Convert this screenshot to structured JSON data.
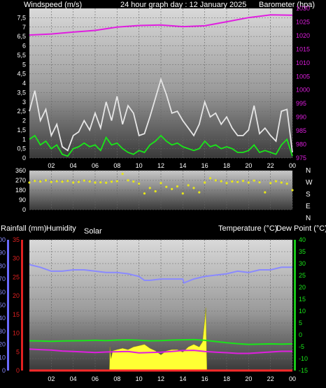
{
  "chart_data": [
    {
      "type": "line",
      "title": "24 hour graph day : 12 January 2025",
      "left_axis_label": "Windspeed (m/s)",
      "right_axis_label": "Barometer (hpa)",
      "x_tick_labels": [
        "02",
        "04",
        "06",
        "08",
        "10",
        "12",
        "14",
        "16",
        "18",
        "20",
        "22",
        "00"
      ],
      "left_ylim": [
        0,
        8
      ],
      "left_ticks": [
        "0",
        "0,5",
        "1",
        "1,5",
        "2",
        "2,5",
        "3",
        "3,5",
        "4",
        "4,5",
        "5",
        "5,5",
        "6",
        "6,5",
        "7",
        "7,5"
      ],
      "right_ylim": [
        975,
        1030
      ],
      "right_ticks": [
        "975",
        "980",
        "985",
        "990",
        "995",
        "1000",
        "1005",
        "1010",
        "1015",
        "1020",
        "1025",
        "1030"
      ],
      "grid": true,
      "series": [
        {
          "key": "barometer",
          "axis": "right",
          "color": "#e01ee0",
          "x": [
            0,
            2,
            4,
            6,
            8,
            10,
            12,
            14,
            16,
            18,
            20,
            22,
            24
          ],
          "values": [
            1020.2,
            1020.6,
            1021.3,
            1021.9,
            1023.1,
            1023.7,
            1023.9,
            1023.3,
            1023.6,
            1025.1,
            1026.6,
            1027.6,
            1027.5
          ]
        },
        {
          "key": "gust",
          "axis": "left",
          "color": "#e6e6e6",
          "x": [
            0,
            0.5,
            1,
            1.5,
            2,
            2.5,
            3,
            3.5,
            4,
            4.5,
            5,
            5.5,
            6,
            6.5,
            7,
            7.5,
            8,
            8.5,
            9,
            9.5,
            10,
            10.5,
            11,
            11.5,
            12,
            12.5,
            13,
            13.5,
            14,
            14.5,
            15,
            15.5,
            16,
            16.5,
            17,
            17.5,
            18,
            18.5,
            19,
            19.5,
            20,
            20.5,
            21,
            21.5,
            22,
            22.5,
            23,
            23.5,
            24
          ],
          "values": [
            2.5,
            3.6,
            2.0,
            2.6,
            1.2,
            1.8,
            0.6,
            0.4,
            1.2,
            1.4,
            2.0,
            1.5,
            2.4,
            1.6,
            3.0,
            2.0,
            3.3,
            1.8,
            2.8,
            2.4,
            1.2,
            1.3,
            2.2,
            3.2,
            4.2,
            3.4,
            2.4,
            2.5,
            2.0,
            1.6,
            1.2,
            1.8,
            3.0,
            2.2,
            2.4,
            1.8,
            2.2,
            1.6,
            1.2,
            1.2,
            1.5,
            2.8,
            1.3,
            1.6,
            1.2,
            0.9,
            2.5,
            2.6,
            0.3
          ]
        },
        {
          "key": "windspeed",
          "axis": "left",
          "color": "#19e619",
          "x": [
            0,
            0.5,
            1,
            1.5,
            2,
            2.5,
            3,
            3.5,
            4,
            4.5,
            5,
            5.5,
            6,
            6.5,
            7,
            7.5,
            8,
            8.5,
            9,
            9.5,
            10,
            10.5,
            11,
            11.5,
            12,
            12.5,
            13,
            13.5,
            14,
            14.5,
            15,
            15.5,
            16,
            16.5,
            17,
            17.5,
            18,
            18.5,
            19,
            19.5,
            20,
            20.5,
            21,
            21.5,
            22,
            22.5,
            23,
            23.5,
            24
          ],
          "values": [
            1.0,
            1.2,
            0.7,
            0.9,
            0.5,
            0.7,
            0.2,
            0.1,
            0.5,
            0.6,
            0.8,
            0.6,
            0.7,
            0.4,
            1.1,
            0.7,
            0.8,
            0.5,
            0.3,
            0.2,
            0.4,
            0.3,
            0.7,
            0.9,
            1.2,
            0.9,
            0.7,
            0.8,
            0.6,
            0.5,
            0.4,
            0.5,
            0.9,
            0.6,
            0.7,
            0.5,
            0.6,
            0.5,
            0.3,
            0.3,
            0.4,
            0.7,
            0.3,
            0.4,
            0.3,
            0.2,
            0.7,
            1.0,
            0.1
          ]
        }
      ]
    },
    {
      "type": "scatter",
      "left_ticks": [
        "0",
        "90",
        "180",
        "270",
        "360"
      ],
      "ylim": [
        0,
        360
      ],
      "compass_labels": [
        "N",
        "W",
        "S",
        "E",
        "N"
      ],
      "series": [
        {
          "key": "wind_direction",
          "color": "#e6e619",
          "x": [
            0,
            0.5,
            1,
            1.5,
            2,
            2.5,
            3,
            3.5,
            4,
            4.5,
            5,
            5.5,
            6,
            6.5,
            7,
            7.5,
            8,
            8.5,
            9,
            9.5,
            10,
            10.5,
            11,
            11.5,
            12,
            12.5,
            13,
            13.5,
            14,
            14.5,
            15,
            15.5,
            16,
            16.5,
            17,
            17.5,
            18,
            18.5,
            19,
            19.5,
            20,
            20.5,
            21,
            21.5,
            22,
            22.5,
            23,
            23.5,
            24
          ],
          "values": [
            250,
            265,
            260,
            270,
            255,
            262,
            258,
            265,
            250,
            255,
            268,
            260,
            250,
            252,
            248,
            258,
            262,
            330,
            270,
            260,
            240,
            150,
            200,
            170,
            245,
            210,
            190,
            215,
            150,
            225,
            200,
            160,
            250,
            290,
            270,
            262,
            245,
            260,
            255,
            265,
            250,
            268,
            252,
            160,
            245,
            262,
            250,
            240,
            180
          ]
        }
      ]
    },
    {
      "type": "line",
      "left_axis_labels": [
        "Rainfall (mm)",
        "Humidity",
        "Solar"
      ],
      "right_axis_labels": [
        "Temperature (°C)",
        "Dew Point (°C)"
      ],
      "x_tick_labels": [
        "02",
        "04",
        "06",
        "08",
        "10",
        "12",
        "14",
        "16",
        "18",
        "20",
        "22",
        "00"
      ],
      "humidity_ticks": [
        "0",
        "10",
        "20",
        "30",
        "40",
        "50",
        "60",
        "70",
        "80",
        "90",
        "100"
      ],
      "rain_ticks": [
        "0",
        "5",
        "10",
        "15",
        "20",
        "25",
        "30",
        "35"
      ],
      "temperature_ticks": [
        "-15",
        "-10",
        "-5",
        "0",
        "5",
        "10",
        "15",
        "20",
        "25",
        "30",
        "35",
        "40"
      ],
      "humidity_ylim": [
        0,
        100
      ],
      "rain_ylim": [
        0,
        35
      ],
      "temperature_ylim": [
        -15,
        40
      ],
      "grid": true,
      "series": [
        {
          "key": "humidity",
          "axis": "humidity",
          "color": "#8a8aff",
          "x": [
            0,
            1,
            2,
            3,
            4,
            5,
            6,
            7,
            8,
            9,
            10,
            10.5,
            11,
            12,
            13,
            14,
            14.1,
            15,
            16,
            17,
            18,
            19,
            20,
            21,
            22,
            23,
            24
          ],
          "values": [
            81,
            79,
            76,
            76,
            77,
            77,
            76,
            75,
            75,
            74,
            72,
            69,
            69,
            70,
            70,
            70,
            67,
            70,
            72,
            73,
            74,
            76,
            75,
            77,
            77,
            79,
            79
          ]
        },
        {
          "key": "temperature",
          "axis": "temperature",
          "color": "#19e619",
          "x": [
            0,
            1,
            2,
            3,
            4,
            5,
            6,
            7,
            8,
            9,
            10,
            11,
            12,
            13,
            14,
            15,
            16,
            17,
            18,
            19,
            20,
            21,
            22,
            23,
            24
          ],
          "values": [
            -2.5,
            -2.6,
            -2.7,
            -2.6,
            -2.5,
            -2.4,
            -2.3,
            -2.4,
            -2.2,
            -2.1,
            -2.3,
            -2.5,
            -2.4,
            -2.2,
            -2.1,
            -2.0,
            -2.3,
            -2.8,
            -3.3,
            -3.7,
            -4.0,
            -3.9,
            -3.8,
            -3.9,
            -3.8
          ]
        },
        {
          "key": "dew_point",
          "axis": "temperature",
          "color": "#e01ee0",
          "x": [
            0,
            1,
            2,
            3,
            4,
            5,
            6,
            7,
            8,
            9,
            10,
            11,
            12,
            13,
            14,
            15,
            16,
            17,
            18,
            19,
            20,
            21,
            22,
            23,
            24
          ],
          "values": [
            -6.0,
            -6.2,
            -6.4,
            -6.8,
            -7.0,
            -7.2,
            -7.4,
            -7.2,
            -7.1,
            -7.0,
            -7.6,
            -7.4,
            -7.3,
            -7.0,
            -6.6,
            -6.5,
            -7.0,
            -7.3,
            -7.5,
            -7.8,
            -7.8,
            -7.5,
            -7.2,
            -6.9,
            -6.9
          ]
        },
        {
          "key": "solar",
          "axis": "humidity",
          "color": "#ffff33",
          "fill": true,
          "x": [
            7.3,
            7.35,
            7.45,
            7.6,
            8,
            8.5,
            9,
            9.5,
            10,
            10.5,
            11,
            11.5,
            12,
            12.5,
            13,
            13.5,
            14,
            14.5,
            15,
            15.5,
            15.8,
            16,
            16.1,
            16.2
          ],
          "values": [
            0,
            18,
            9,
            15,
            16,
            17,
            16,
            18,
            19,
            20,
            17,
            15,
            12,
            15,
            16,
            16,
            14,
            18,
            20,
            18,
            22,
            38,
            48,
            0
          ]
        },
        {
          "key": "rainfall",
          "axis": "rain",
          "color": "#ff2a2a",
          "x": [
            0,
            24
          ],
          "values": [
            0,
            0
          ]
        }
      ]
    }
  ]
}
